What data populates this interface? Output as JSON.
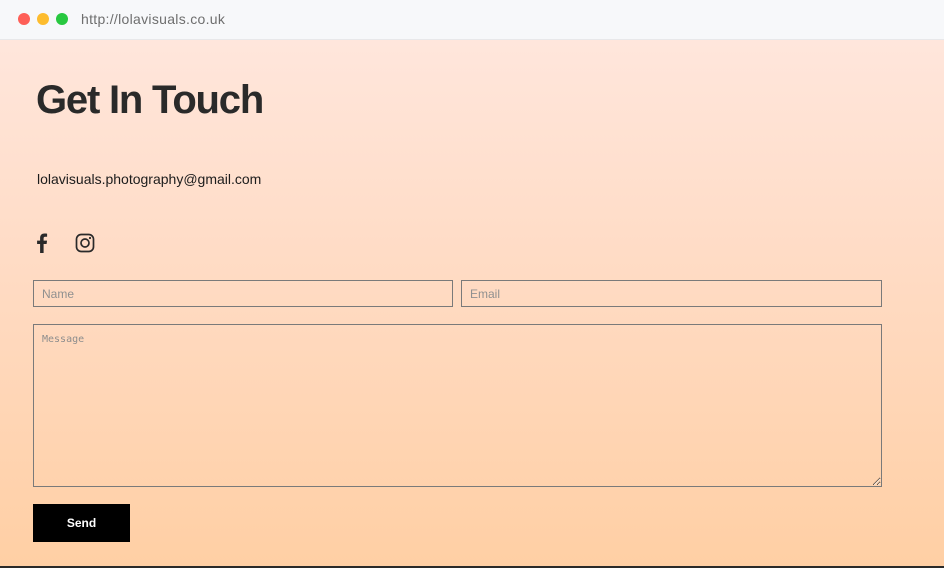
{
  "browser": {
    "url": "http://lolavisuals.co.uk"
  },
  "page": {
    "title": "Get In Touch",
    "email": "lolavisuals.photography@gmail.com",
    "social": [
      {
        "icon": "facebook-icon"
      },
      {
        "icon": "instagram-icon"
      }
    ]
  },
  "form": {
    "name_placeholder": "Name",
    "email_placeholder": "Email",
    "message_placeholder": "Message",
    "send_label": "Send"
  },
  "colors": {
    "gradient_top": "#ffe6dc",
    "gradient_bottom": "#ffcfa4",
    "button": "#000000"
  }
}
